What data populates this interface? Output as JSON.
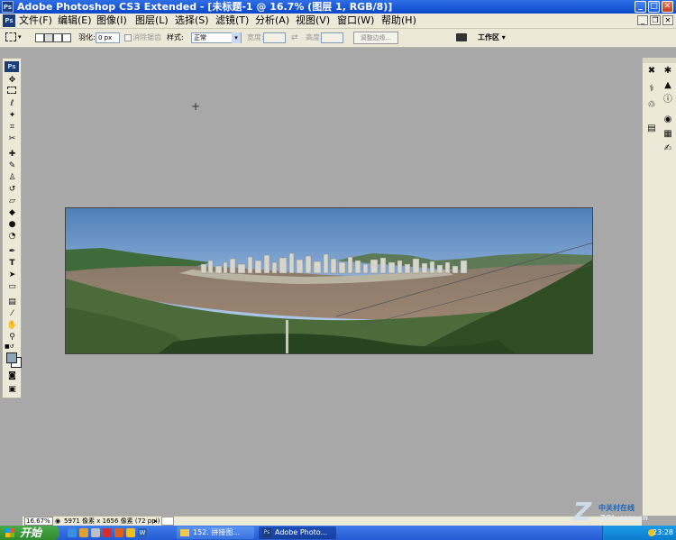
{
  "window": {
    "title": "Adobe Photoshop CS3 Extended - [未标题-1 @ 16.7% (图层 1, RGB/8)]",
    "app_icon": "Ps"
  },
  "menu": {
    "items": [
      "文件(F)",
      "编辑(E)",
      "图像(I)",
      "图层(L)",
      "选择(S)",
      "滤镜(T)",
      "分析(A)",
      "视图(V)",
      "窗口(W)",
      "帮助(H)"
    ]
  },
  "options": {
    "feather_label": "羽化:",
    "feather_value": "0 px",
    "antialias_label": "消除锯齿",
    "style_label": "样式:",
    "style_value": "正常",
    "width_label": "宽度:",
    "height_label": "高度:",
    "refine_edge": "调整边缘...",
    "workspace": "工作区"
  },
  "toolbox": {
    "badge": "Ps"
  },
  "status": {
    "zoom": "16.67%",
    "doc_info": "5971 像素 x 1656 像素 (72 ppi)"
  },
  "taskbar": {
    "start": "开始",
    "tasks": [
      "152. 拼接图...",
      "Adobe Photo..."
    ],
    "clock": "23:28"
  },
  "watermark": {
    "brand": "中关村在线",
    "url": "ZOL.com.cn",
    "logo_letter": "Z"
  },
  "colors": {
    "titlebar": "#0a46c9",
    "chrome": "#ece9d8",
    "workspace": "#a8a8a8",
    "taskbar": "#245bd4",
    "start_button": "#2f8a2f"
  }
}
